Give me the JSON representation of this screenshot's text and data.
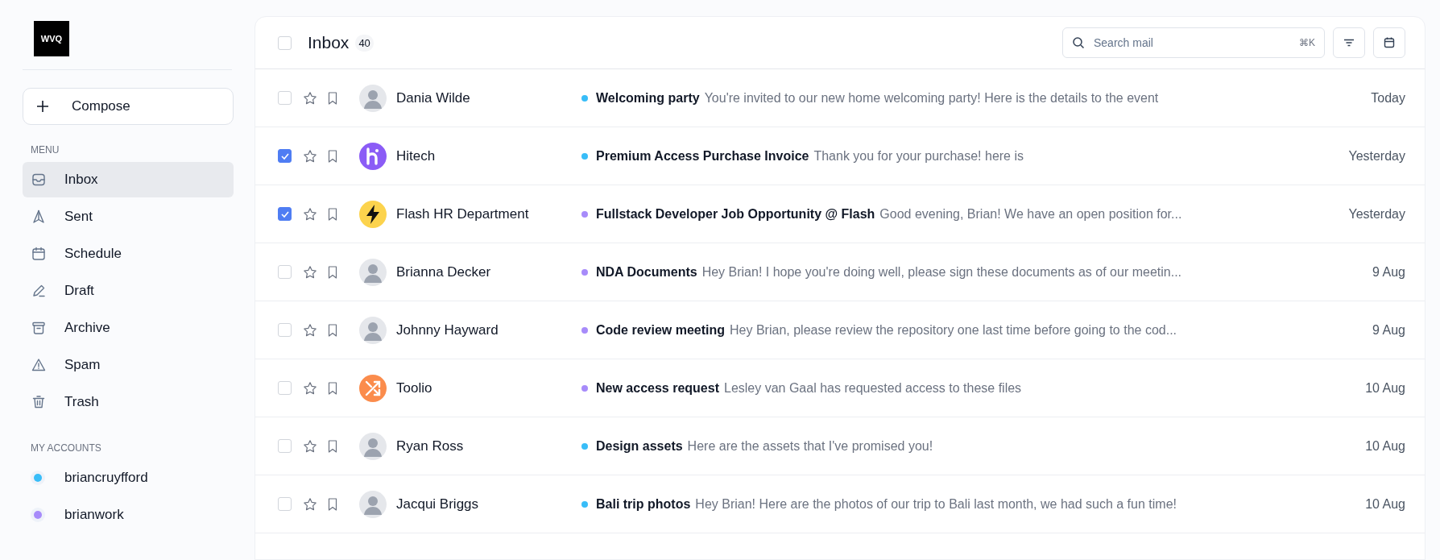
{
  "logo": {
    "text": "WVQ"
  },
  "compose_button": {
    "label": "Compose"
  },
  "menu": {
    "heading": "MENU",
    "items": [
      {
        "label": "Inbox",
        "selected": true
      },
      {
        "label": "Sent",
        "selected": false
      },
      {
        "label": "Schedule",
        "selected": false
      },
      {
        "label": "Draft",
        "selected": false
      },
      {
        "label": "Archive",
        "selected": false
      },
      {
        "label": "Spam",
        "selected": false
      },
      {
        "label": "Trash",
        "selected": false
      }
    ]
  },
  "accounts": {
    "heading": "MY ACCOUNTS",
    "items": [
      {
        "label": "briancruyfford",
        "color": "#38bdf8"
      },
      {
        "label": "brianwork",
        "color": "#a78bfa"
      }
    ]
  },
  "inbox": {
    "title": "Inbox",
    "count": "40",
    "select_all_checked": false,
    "search": {
      "placeholder": "Search mail",
      "shortcut": "⌘K"
    },
    "rows": [
      {
        "sender": "Dania Wilde",
        "kind": "person",
        "checked": false,
        "color": "#38bdf8",
        "subject": "Welcoming party",
        "preview": "You're invited to our new home welcoming party! Here is the details to the event",
        "date": "Today"
      },
      {
        "sender": "Hitech",
        "kind": "h-logo",
        "checked": true,
        "color": "#38bdf8",
        "subject": "Premium Access Purchase Invoice",
        "preview": "Thank you for your purchase! here is",
        "date": "Yesterday"
      },
      {
        "sender": "Flash HR Department",
        "kind": "bolt",
        "checked": true,
        "color": "#a78bfa",
        "subject": "Fullstack Developer Job Opportunity @ Flash",
        "preview": "Good evening, Brian! We have an open position for...",
        "date": "Yesterday"
      },
      {
        "sender": "Brianna Decker",
        "kind": "person",
        "checked": false,
        "color": "#a78bfa",
        "subject": "NDA Documents",
        "preview": "Hey Brian! I hope you're doing well, please sign these documents as of our meetin...",
        "date": "9 Aug"
      },
      {
        "sender": "Johnny Hayward",
        "kind": "person",
        "checked": false,
        "color": "#a78bfa",
        "subject": "Code review meeting",
        "preview": "Hey Brian, please review the repository one last time before going to the cod...",
        "date": "9 Aug"
      },
      {
        "sender": "Toolio",
        "kind": "shuffle",
        "checked": false,
        "color": "#a78bfa",
        "subject": "New access request",
        "preview": "Lesley van Gaal has requested access to these files",
        "date": "10 Aug"
      },
      {
        "sender": "Ryan Ross",
        "kind": "person",
        "checked": false,
        "color": "#38bdf8",
        "subject": "Design assets",
        "preview": "Here are the assets that I've promised you!",
        "date": "10 Aug"
      },
      {
        "sender": "Jacqui Briggs",
        "kind": "person",
        "checked": false,
        "color": "#38bdf8",
        "subject": "Bali trip photos",
        "preview": "Hey Brian! Here are the photos of our trip to Bali last month, we had such a fun time!",
        "date": "10 Aug"
      }
    ]
  }
}
